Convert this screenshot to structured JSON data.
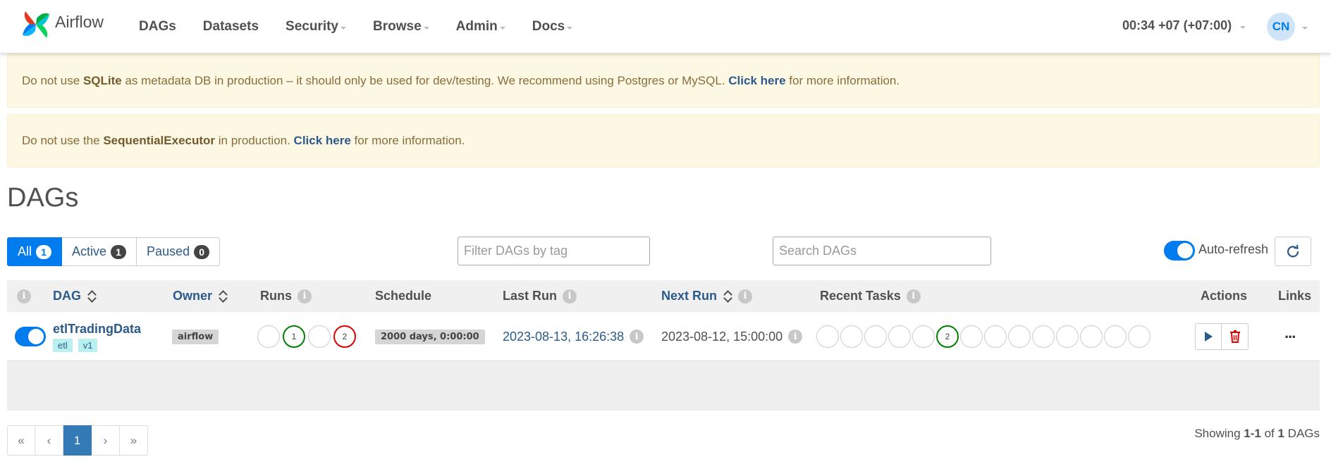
{
  "navbar": {
    "brand": "Airflow",
    "items": [
      {
        "label": "DAGs",
        "caret": false
      },
      {
        "label": "Datasets",
        "caret": false
      },
      {
        "label": "Security",
        "caret": true
      },
      {
        "label": "Browse",
        "caret": true
      },
      {
        "label": "Admin",
        "caret": true
      },
      {
        "label": "Docs",
        "caret": true
      }
    ],
    "clock": "00:34 +07 (+07:00)",
    "user_initials": "CN"
  },
  "alerts": {
    "sqlite": {
      "pre": "Do not use ",
      "bold": "SQLite",
      "mid": " as metadata DB in production – it should only be used for dev/testing. We recommend using Postgres or MySQL. ",
      "link": "Click here",
      "post": " for more information."
    },
    "executor": {
      "pre": "Do not use the ",
      "bold": "SequentialExecutor",
      "mid": " in production. ",
      "link": "Click here",
      "post": " for more information."
    }
  },
  "page_title": "DAGs",
  "filters": [
    {
      "label": "All",
      "count": "1"
    },
    {
      "label": "Active",
      "count": "1"
    },
    {
      "label": "Paused",
      "count": "0"
    }
  ],
  "tag_filter_placeholder": "Filter DAGs by tag",
  "search_placeholder": "Search DAGs",
  "autorefresh_label": "Auto-refresh",
  "table": {
    "headers": {
      "dag": "DAG",
      "owner": "Owner",
      "runs": "Runs",
      "schedule": "Schedule",
      "last_run": "Last Run",
      "next_run": "Next Run",
      "recent_tasks": "Recent Tasks",
      "actions": "Actions",
      "links": "Links"
    },
    "rows": [
      {
        "dag_id": "etlTradingData",
        "tags": [
          "etl",
          "v1"
        ],
        "owner": "airflow",
        "runs": {
          "c1": "1",
          "c2": "2"
        },
        "schedule": "2000 days, 0:00:00",
        "last_run": "2023-08-13, 16:26:38",
        "next_run": "2023-08-12, 15:00:00",
        "recent_task_count": "2",
        "links_icon": "..."
      }
    ]
  },
  "pagination": {
    "first": "«",
    "prev": "‹",
    "page": "1",
    "next": "›",
    "last": "»"
  },
  "showing": {
    "pre": "Showing ",
    "range": "1-1",
    "mid": " of ",
    "total": "1",
    "post": " DAGs"
  },
  "colors": {
    "primary": "#017cee",
    "link": "#2b5a8b",
    "success": "#008000",
    "failed": "#e00000",
    "alert_bg": "#fcf8e3"
  }
}
